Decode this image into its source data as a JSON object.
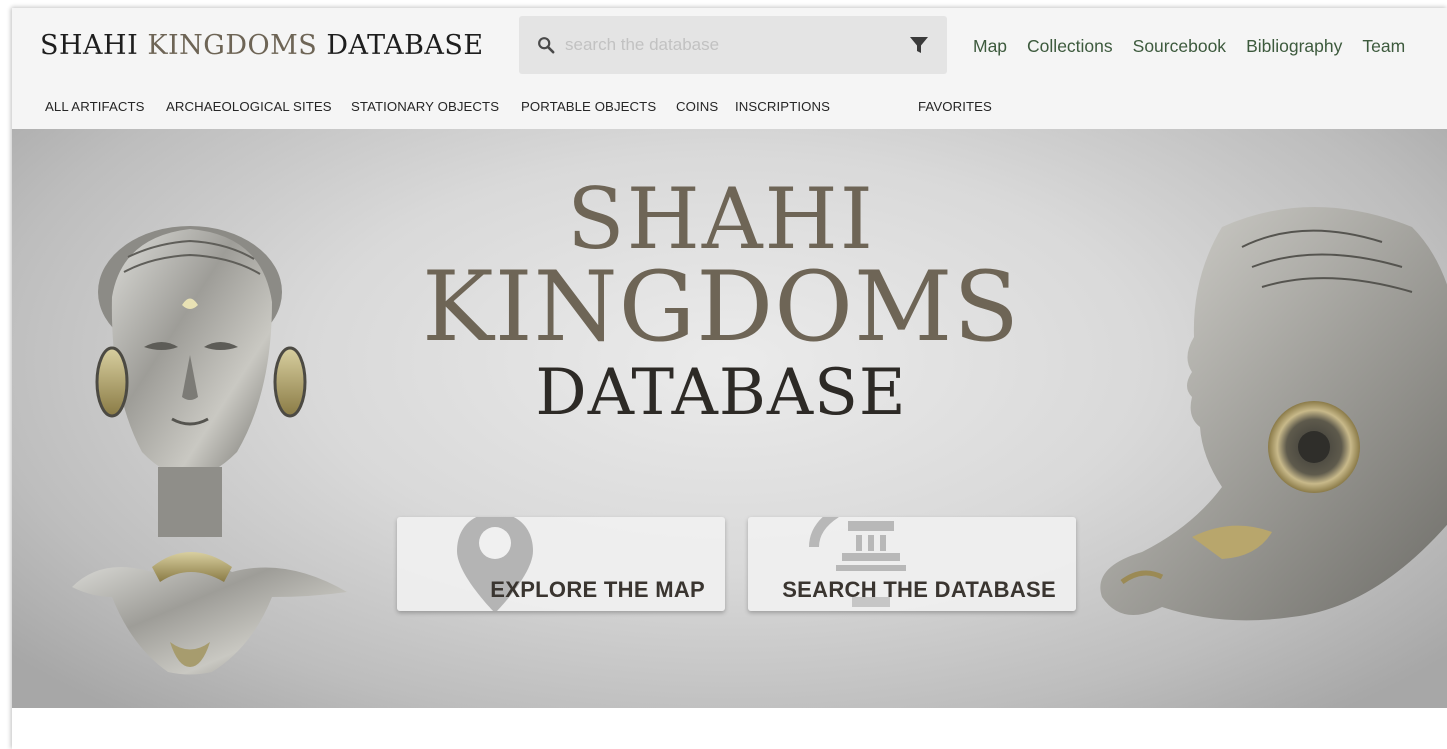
{
  "brand": {
    "part1": "SHAHI ",
    "part2": "KINGDOMS",
    "part3": " DATABASE"
  },
  "search": {
    "placeholder": "search the database",
    "value": ""
  },
  "top_nav": [
    "Map",
    "Collections",
    "Sourcebook",
    "Bibliography",
    "Team"
  ],
  "categories": {
    "all": "ALL ARTIFACTS",
    "sites": "ARCHAEOLOGICAL SITES",
    "stationary": "STATIONARY OBJECTS",
    "portable": "PORTABLE OBJECTS",
    "coins": "COINS",
    "inscriptions": "INSCRIPTIONS",
    "favorites": "FAVORITES"
  },
  "hero": {
    "line1": "SHAHI",
    "line2": "KINGDOMS",
    "line3": "DATABASE",
    "cta_map": "EXPLORE THE MAP",
    "cta_db": "SEARCH THE DATABASE"
  },
  "icons": {
    "search": "search-icon",
    "filter": "filter-icon",
    "map_pin": "map-pin-icon",
    "temple": "temple-icon"
  },
  "colors": {
    "header_bg": "#f5f5f5",
    "nav_link": "#3d5a3d",
    "title_accent": "#6e6556",
    "title_dark": "#2d2a26"
  }
}
